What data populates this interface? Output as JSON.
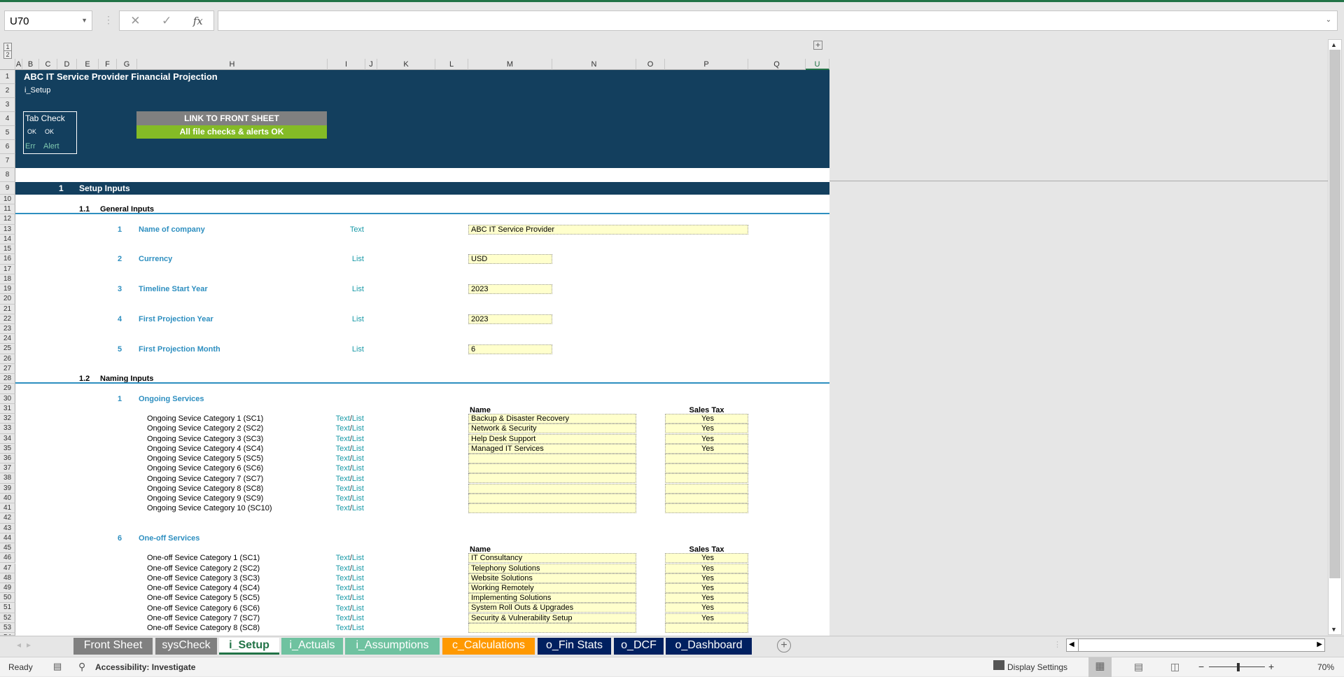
{
  "formula_bar": {
    "name_box": "U70",
    "cancel_icon": "✕",
    "enter_icon": "✓",
    "fx_label": "fx",
    "formula": ""
  },
  "outline_levels": [
    "1",
    "2"
  ],
  "columns": [
    {
      "label": "A",
      "sel": false
    },
    {
      "label": "B",
      "sel": false
    },
    {
      "label": "C",
      "sel": false
    },
    {
      "label": "D",
      "sel": false
    },
    {
      "label": "E",
      "sel": false
    },
    {
      "label": "F",
      "sel": false
    },
    {
      "label": "G",
      "sel": false
    },
    {
      "label": "H",
      "sel": false
    },
    {
      "label": "I",
      "sel": false
    },
    {
      "label": "J",
      "sel": false
    },
    {
      "label": "K",
      "sel": false
    },
    {
      "label": "L",
      "sel": false
    },
    {
      "label": "M",
      "sel": false
    },
    {
      "label": "N",
      "sel": false
    },
    {
      "label": "O",
      "sel": false
    },
    {
      "label": "P",
      "sel": false
    },
    {
      "label": "Q",
      "sel": false
    },
    {
      "label": "U",
      "sel": true
    }
  ],
  "header": {
    "title": "ABC IT Service Provider Financial Projection",
    "sheet_name": "i_Setup",
    "tab_check": {
      "label": "Tab Check",
      "ok1": "OK",
      "ok2": "OK",
      "err": "Err",
      "alert": "Alert"
    },
    "link_button": "LINK TO FRONT SHEET",
    "status_bar": "All file checks & alerts OK"
  },
  "colors": {
    "band": "#133f5e",
    "ok_green": "#84bb26",
    "accent_blue": "#2e8fc0",
    "input_yellow": "#ffffcc"
  },
  "section": {
    "num": "1",
    "title": "Setup Inputs"
  },
  "general": {
    "num": "1.1",
    "title": "General Inputs",
    "items": [
      {
        "row": 13,
        "num": "1",
        "label": "Name of company",
        "type": "Text",
        "value": "ABC IT Service Provider",
        "wide": true
      },
      {
        "row": 16,
        "num": "2",
        "label": "Currency",
        "type": "List",
        "value": "USD",
        "wide": false
      },
      {
        "row": 19,
        "num": "3",
        "label": "Timeline Start Year",
        "type": "List",
        "value": "2023",
        "wide": false
      },
      {
        "row": 22,
        "num": "4",
        "label": "First Projection Year",
        "type": "List",
        "value": "2023",
        "wide": false
      },
      {
        "row": 25,
        "num": "5",
        "label": "First Projection Month",
        "type": "List",
        "value": "6",
        "wide": false
      }
    ]
  },
  "naming": {
    "num": "1.2",
    "title": "Naming Inputs",
    "groups": [
      {
        "row": 30,
        "num": "1",
        "title": "Ongoing Services",
        "hdr_row": 31,
        "name_header": "Name",
        "tax_header": "Sales Tax",
        "rows": [
          {
            "row": 32,
            "label": "Ongoing Sevice Category 1 (SC1)",
            "name": "Backup & Disaster Recovery",
            "tax": "Yes"
          },
          {
            "row": 33,
            "label": "Ongoing Sevice Category 2 (SC2)",
            "name": "Network & Security",
            "tax": "Yes"
          },
          {
            "row": 34,
            "label": "Ongoing Sevice Category 3 (SC3)",
            "name": "Help Desk Support",
            "tax": "Yes"
          },
          {
            "row": 35,
            "label": "Ongoing Sevice Category 4 (SC4)",
            "name": "Managed IT Services",
            "tax": "Yes"
          },
          {
            "row": 36,
            "label": "Ongoing Sevice Category 5 (SC5)",
            "name": "",
            "tax": ""
          },
          {
            "row": 37,
            "label": "Ongoing Sevice Category 6 (SC6)",
            "name": "",
            "tax": ""
          },
          {
            "row": 38,
            "label": "Ongoing Sevice Category 7 (SC7)",
            "name": "",
            "tax": ""
          },
          {
            "row": 39,
            "label": "Ongoing Sevice Category 8 (SC8)",
            "name": "",
            "tax": ""
          },
          {
            "row": 40,
            "label": "Ongoing Sevice Category 9 (SC9)",
            "name": "",
            "tax": ""
          },
          {
            "row": 41,
            "label": "Ongoing Sevice Category 10 (SC10)",
            "name": "",
            "tax": ""
          }
        ]
      },
      {
        "row": 44,
        "num": "6",
        "title": "One-off Services",
        "hdr_row": 45,
        "name_header": "Name",
        "tax_header": "Sales Tax",
        "rows": [
          {
            "row": 46,
            "label": "One-off Sevice Category 1 (SC1)",
            "name": "IT Consultancy",
            "tax": "Yes"
          },
          {
            "row": 47,
            "label": "One-off Sevice Category 2 (SC2)",
            "name": "Telephony Solutions",
            "tax": "Yes"
          },
          {
            "row": 48,
            "label": "One-off Sevice Category 3 (SC3)",
            "name": "Website Solutions",
            "tax": "Yes"
          },
          {
            "row": 49,
            "label": "One-off Sevice Category 4 (SC4)",
            "name": "Working Remotely",
            "tax": "Yes"
          },
          {
            "row": 50,
            "label": "One-off Sevice Category 5 (SC5)",
            "name": "Implementing Solutions",
            "tax": "Yes"
          },
          {
            "row": 51,
            "label": "One-off Sevice Category 6 (SC6)",
            "name": "System Roll Outs & Upgrades",
            "tax": "Yes"
          },
          {
            "row": 52,
            "label": "One-off Sevice Category 7 (SC7)",
            "name": "Security & Vulnerability Setup",
            "tax": "Yes"
          },
          {
            "row": 53,
            "label": "One-off Sevice Category 8 (SC8)",
            "name": "",
            "tax": ""
          }
        ]
      }
    ],
    "type_text": "Text",
    "type_sep": "/",
    "type_list": "List"
  },
  "sheet_tabs": [
    {
      "label": "Front Sheet",
      "color": "#808080",
      "active": false
    },
    {
      "label": "sysCheck",
      "color": "#808080",
      "active": false
    },
    {
      "label": "i_Setup",
      "color": "#ffffff",
      "active": true
    },
    {
      "label": "i_Actuals",
      "color": "#6fc2a0",
      "active": false
    },
    {
      "label": "i_Assumptions",
      "color": "#6fc2a0",
      "active": false
    },
    {
      "label": "c_Calculations",
      "color": "#ff9900",
      "active": false
    },
    {
      "label": "o_Fin Stats",
      "color": "#002060",
      "active": false
    },
    {
      "label": "o_DCF",
      "color": "#002060",
      "active": false
    },
    {
      "label": "o_Dashboard",
      "color": "#002060",
      "active": false
    }
  ],
  "status": {
    "ready": "Ready",
    "accessibility": "Accessibility: Investigate",
    "display_settings": "Display Settings",
    "zoom": "70%",
    "zoom_minus": "−",
    "zoom_plus": "+",
    "add_sheet": "+"
  }
}
